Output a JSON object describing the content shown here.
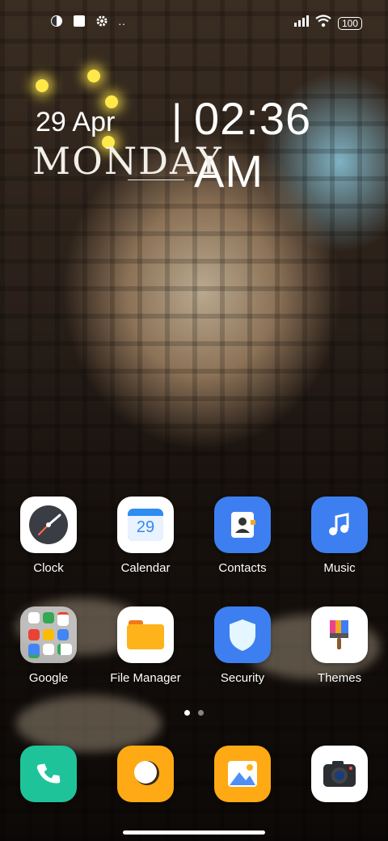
{
  "status_bar": {
    "battery": "100",
    "more": "··"
  },
  "clock_widget": {
    "date": "29 Apr",
    "separator": "|",
    "time": "02:36 AM",
    "day": "MONDAY"
  },
  "home_rows": [
    [
      {
        "label": "Clock",
        "icon": "clock-icon"
      },
      {
        "label": "Calendar",
        "icon": "calendar-icon",
        "badge": "29"
      },
      {
        "label": "Contacts",
        "icon": "contacts-icon"
      },
      {
        "label": "Music",
        "icon": "music-note-icon"
      }
    ],
    [
      {
        "label": "Google",
        "icon": "google-folder-icon"
      },
      {
        "label": "File Manager",
        "icon": "folder-icon"
      },
      {
        "label": "Security",
        "icon": "shield-icon"
      },
      {
        "label": "Themes",
        "icon": "paintbrush-icon"
      }
    ]
  ],
  "page_indicator": {
    "pages": 2,
    "current": 1
  },
  "dock": [
    {
      "icon": "phone-icon"
    },
    {
      "icon": "messages-icon"
    },
    {
      "icon": "gallery-icon"
    },
    {
      "icon": "camera-icon"
    }
  ]
}
